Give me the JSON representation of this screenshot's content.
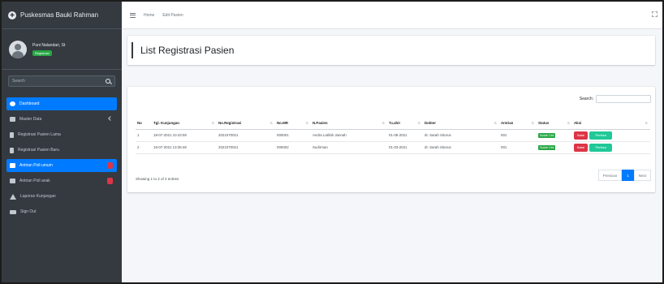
{
  "app": {
    "brand": "Puskesmas Bauki Rahman",
    "user_name": "Puni Nalandari, St",
    "user_role": "Registrasi"
  },
  "sidebar": {
    "search_placeholder": "Search",
    "items": [
      {
        "label": "Dashboard",
        "icon": "dashboard-icon",
        "active": true
      },
      {
        "label": "Master Data",
        "icon": "database-icon",
        "active": false
      },
      {
        "label": "Registrasi Pasien Lama",
        "icon": "file-icon",
        "active": false
      },
      {
        "label": "Registrasi Pasien Baru",
        "icon": "file-icon",
        "active": false
      },
      {
        "label": "Antrian Poli umum",
        "icon": "list-icon",
        "active": false
      },
      {
        "label": "Antrian Poli anak",
        "icon": "list-icon",
        "active": false
      },
      {
        "label": "Laporan Kunjungan",
        "icon": "report-icon",
        "active": false
      },
      {
        "label": "Sign Out",
        "icon": "sign-out-icon",
        "active": false
      }
    ]
  },
  "topbar": {
    "home": "Home",
    "breadcrumb": "Edit Pasien"
  },
  "page": {
    "title": "List Registrasi Pasien"
  },
  "table": {
    "search_label": "Search:",
    "columns": [
      "No",
      "Tgl. Kunjungan",
      "No.Registrasi",
      "No.MR",
      "N.Pasien",
      "T.Lahir",
      "Dokter",
      "Antrian",
      "Status",
      "Aksi"
    ],
    "rows": [
      {
        "no": "1",
        "tgl": "18-07-2021 10:43:08",
        "reg": "2021070021",
        "mr": "000001",
        "nama": "Andra Latifah Jannah",
        "lahir": "01-08-2021",
        "dokter": "dr. Sarah Sitorus",
        "antrian": "001",
        "status": "Sudah Cek"
      },
      {
        "no": "2",
        "tgl": "18-07-2021 13:35:48",
        "reg": "2021070021",
        "mr": "000002",
        "nama": "Sudirman",
        "lahir": "01-03-2021",
        "dokter": "dr. Sarah Sitorus",
        "antrian": "001",
        "status": "Sudah Cek"
      }
    ],
    "btn_delete": "Batal",
    "btn_edit": "Periksa",
    "info": "Showing 1 to 2 of 2 entries",
    "pager": {
      "prev": "Previous",
      "current": "1",
      "next": "Next"
    }
  }
}
